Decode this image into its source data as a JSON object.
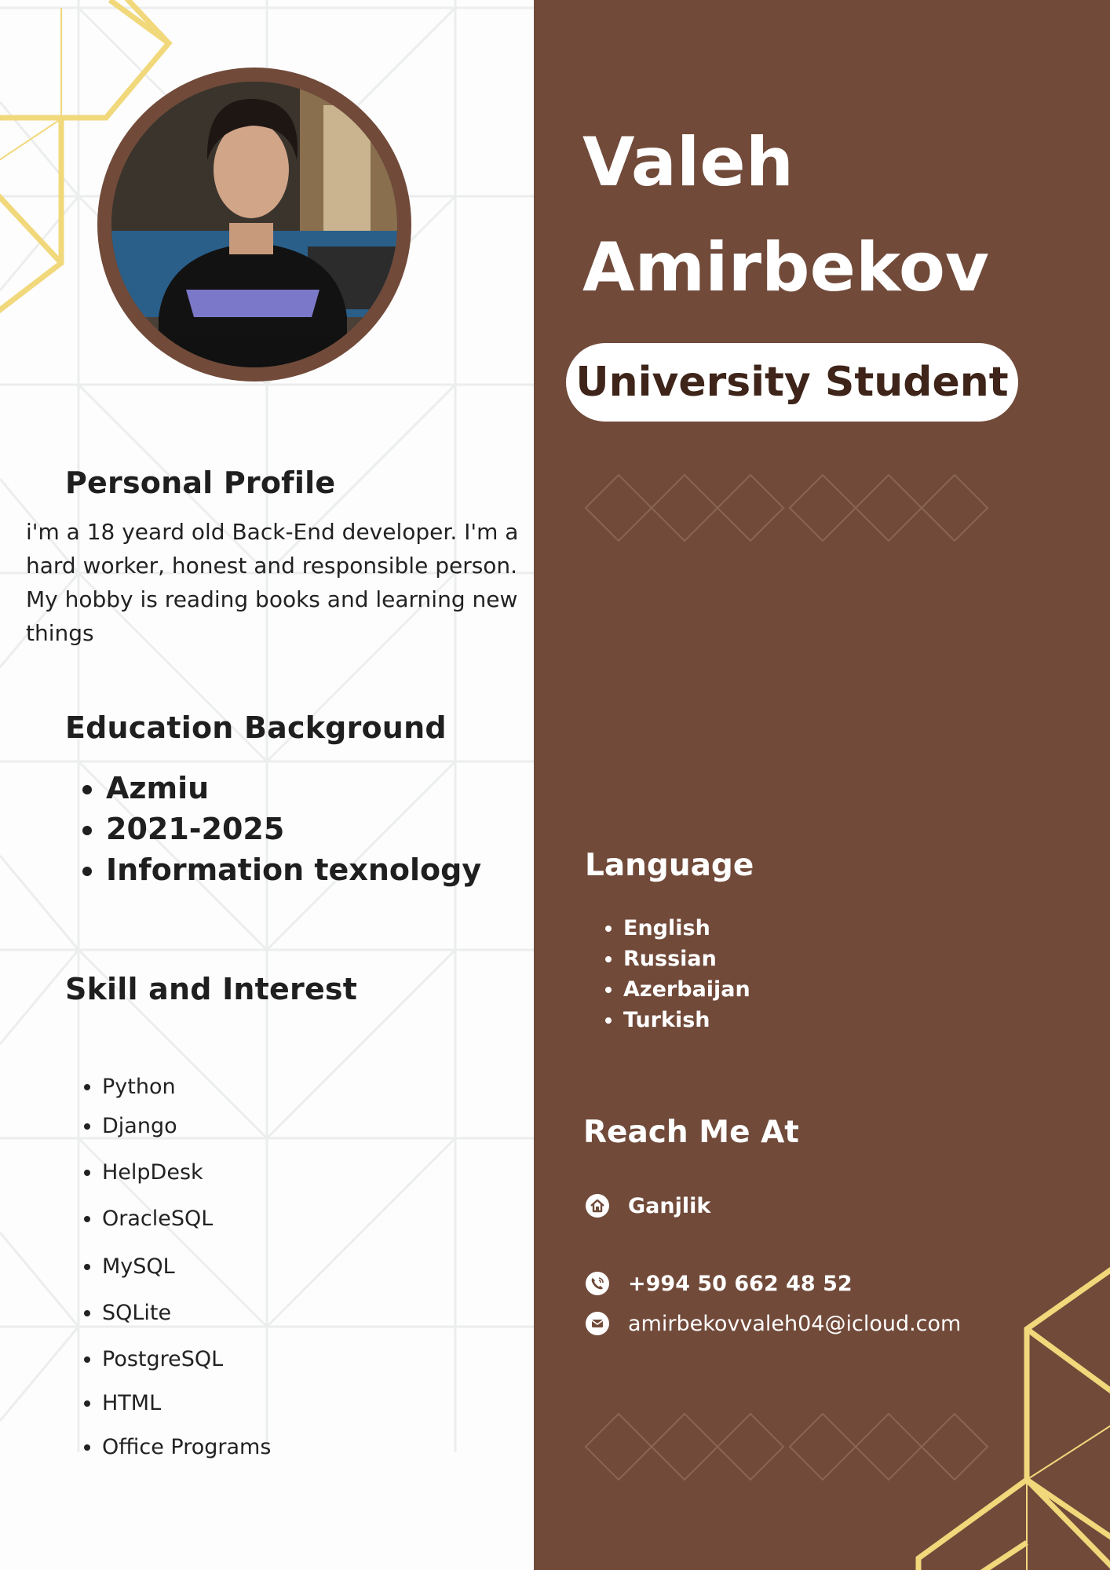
{
  "header": {
    "first_name": "Valeh",
    "last_name": "Amirbekov",
    "role": "University Student"
  },
  "photo": {
    "alt": "Profile photo"
  },
  "profile": {
    "heading": "Personal Profile",
    "text": "i'm a 18 yeard old Back-End developer. I'm a hard worker, honest and responsible person. My hobby is reading books and learning new things"
  },
  "education": {
    "heading": "Education Background",
    "items": [
      "Azmiu",
      "2021-2025",
      "Information texnology"
    ]
  },
  "skills": {
    "heading": "Skill and Interest",
    "items": [
      "Python",
      "Django",
      "HelpDesk",
      "OracleSQL",
      "MySQL",
      "SQLite",
      "PostgreSQL",
      "HTML",
      "Office Programs"
    ]
  },
  "languages": {
    "heading": "Language",
    "items": [
      "English",
      "Russian",
      "Azerbaijan",
      "Turkish"
    ]
  },
  "contact": {
    "heading": "Reach Me At",
    "address": "Ganjlik",
    "phone": "+994 50 662 48 52",
    "email": "amirbekovvaleh04@icloud.com"
  },
  "colors": {
    "brown": "#714a3a",
    "gold": "#f1d87b",
    "badge_text": "#3e2419"
  },
  "icons": [
    "home-icon",
    "phone-icon",
    "email-icon"
  ]
}
